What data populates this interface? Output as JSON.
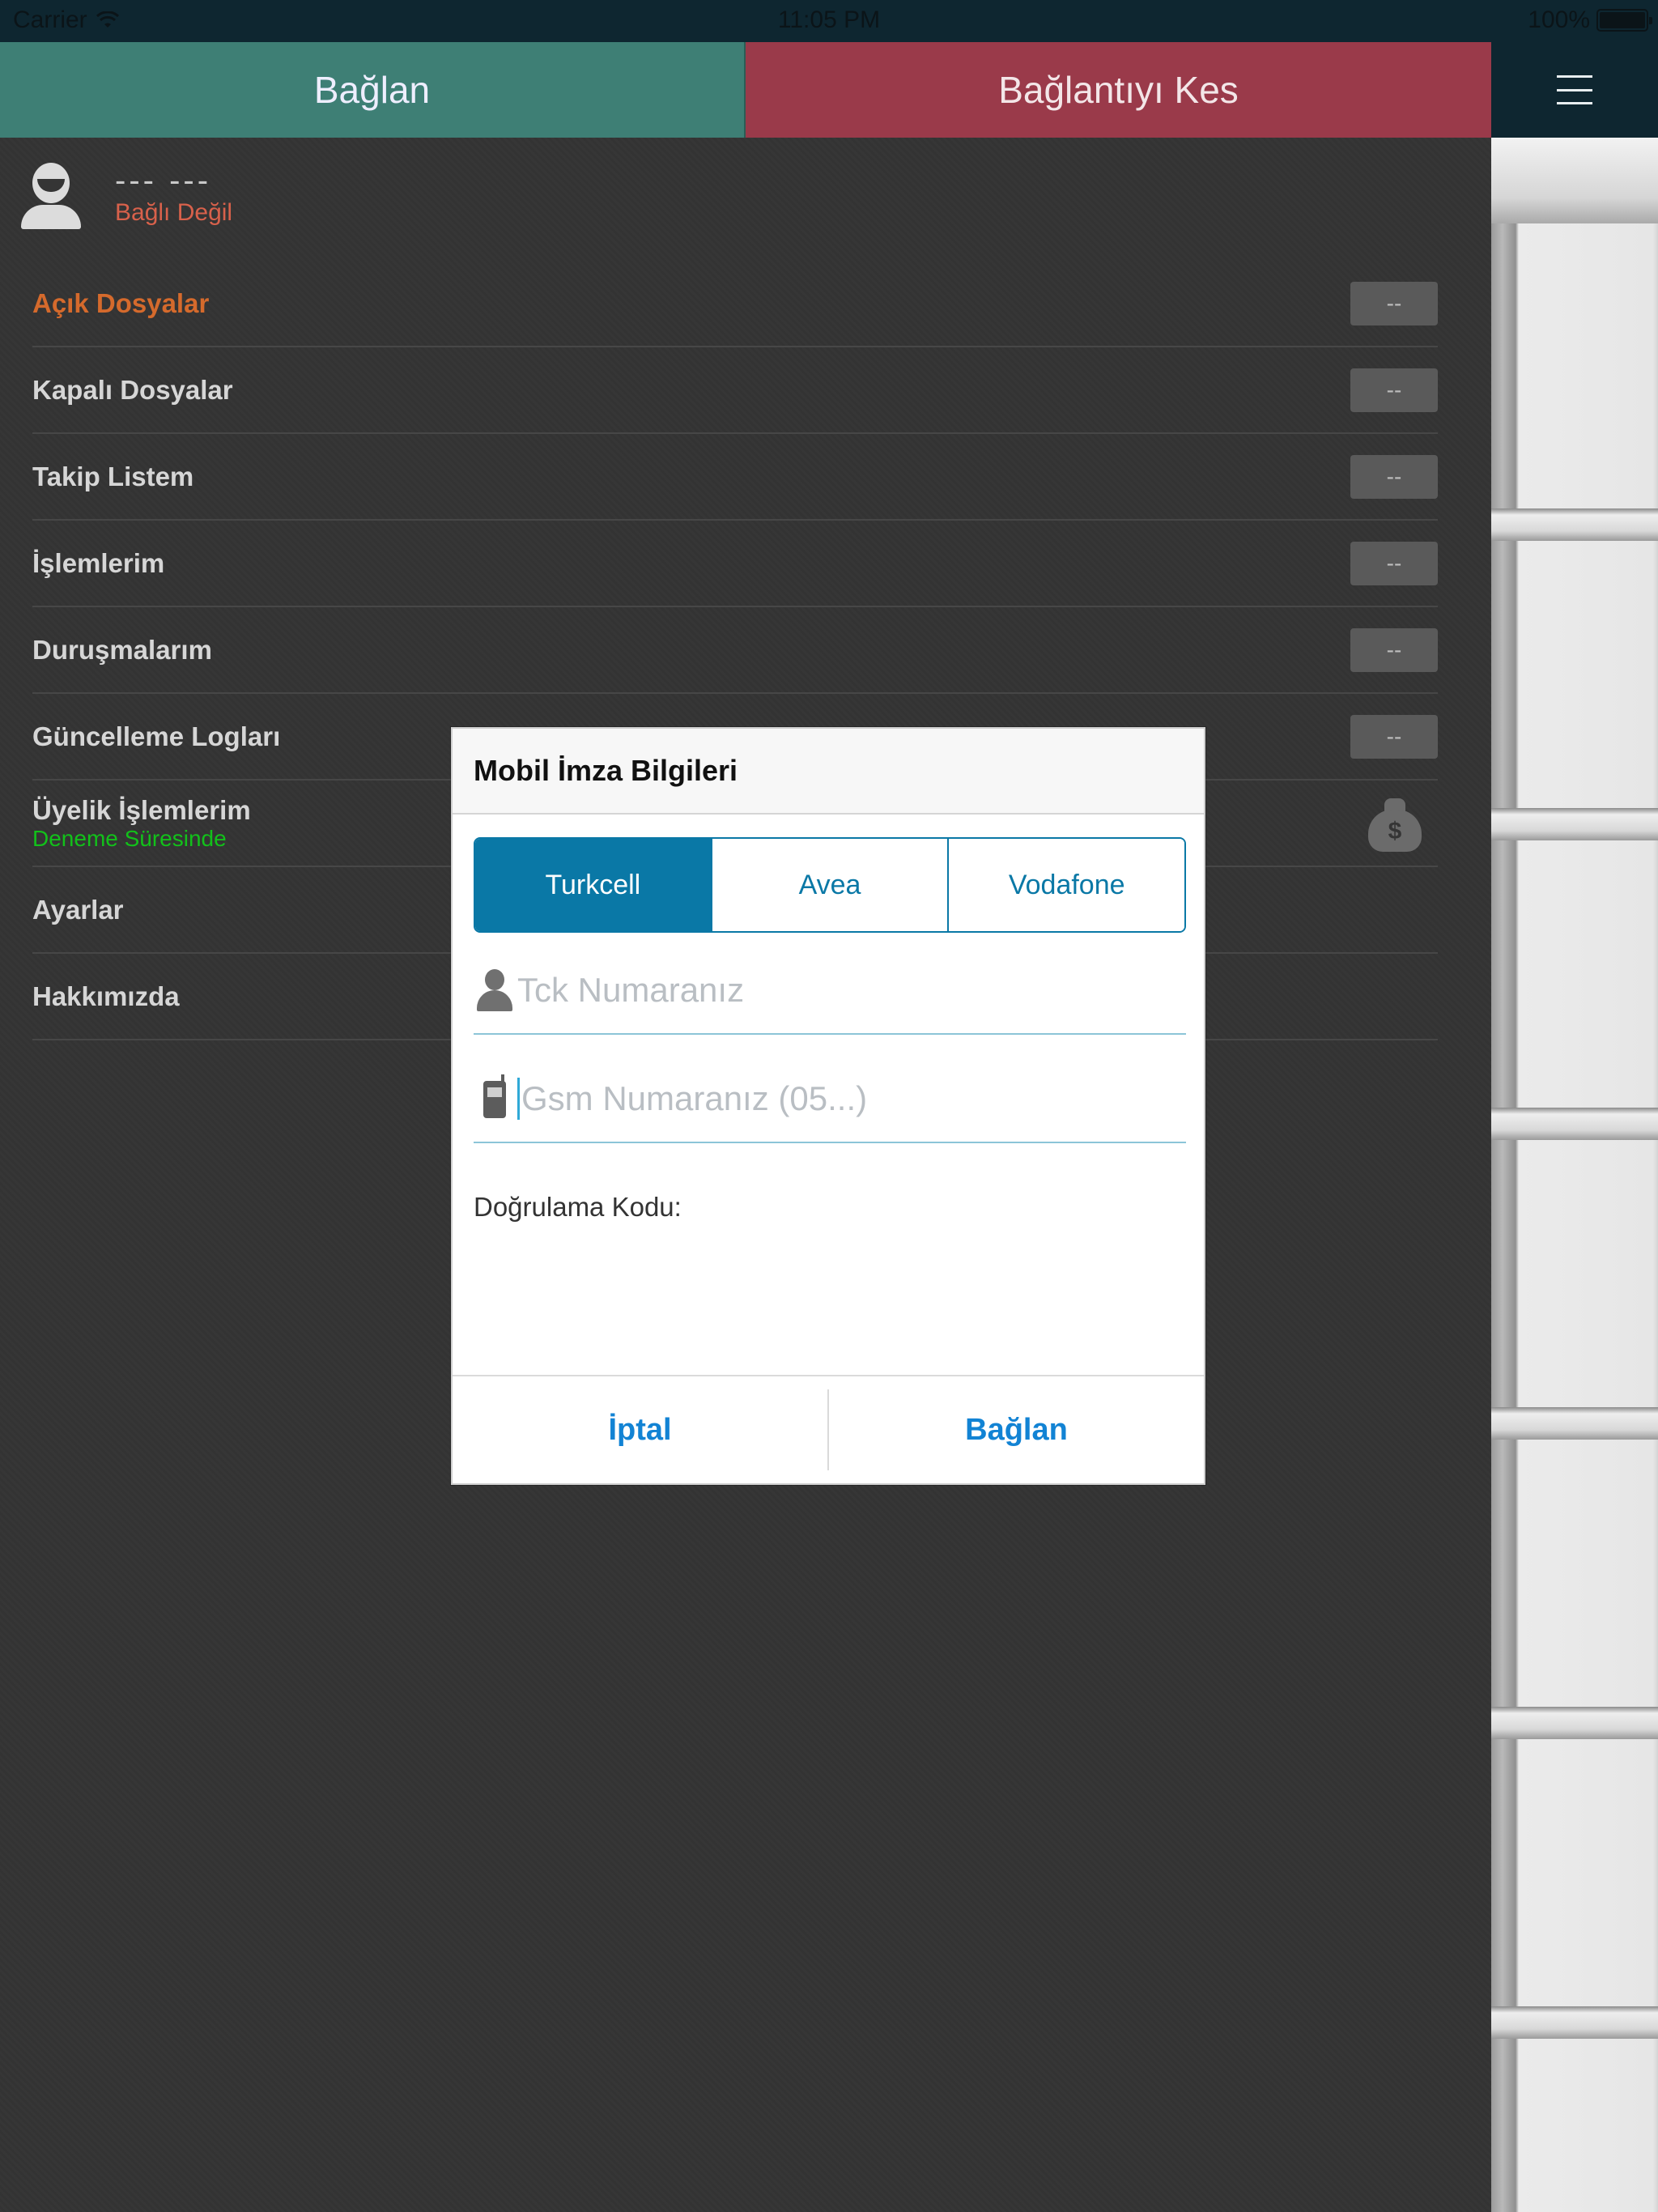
{
  "status_bar": {
    "carrier": "Carrier",
    "time": "11:05 PM",
    "battery": "100%"
  },
  "topbar": {
    "connect_label": "Bağlan",
    "disconnect_label": "Bağlantıyı Kes",
    "menu_icon": "hamburger-icon"
  },
  "user": {
    "name": "--- ---",
    "status": "Bağlı Değil"
  },
  "menu": {
    "items": [
      {
        "label": "Açık Dosyalar",
        "count": "--"
      },
      {
        "label": "Kapalı Dosyalar",
        "count": "--"
      },
      {
        "label": "Takip Listem",
        "count": "--"
      },
      {
        "label": "İşlemlerim",
        "count": "--"
      },
      {
        "label": "Duruşmalarım",
        "count": "--"
      },
      {
        "label": "Güncelleme Logları",
        "count": "--"
      },
      {
        "label": "Üyelik İşlemlerim",
        "sub": "Deneme Süresinde",
        "icon": "money-bag-icon"
      },
      {
        "label": "Ayarlar"
      },
      {
        "label": "Hakkımızda"
      }
    ]
  },
  "dialog": {
    "title": "Mobil İmza Bilgileri",
    "operators": [
      "Turkcell",
      "Avea",
      "Vodafone"
    ],
    "selected_operator": "Turkcell",
    "tck_placeholder": "Tck Numaranız",
    "gsm_placeholder": "Gsm Numaranız (05...)",
    "verification_label": "Doğrulama Kodu:",
    "cancel_label": "İptal",
    "connect_label": "Bağlan"
  },
  "colors": {
    "connect_bg": "#3e7f75",
    "disconnect_bg": "#9a3a4a",
    "active_menu": "#d56a2c",
    "segment_accent": "#0a78a6",
    "action_blue": "#1283d4",
    "trial_green": "#12c11a"
  }
}
